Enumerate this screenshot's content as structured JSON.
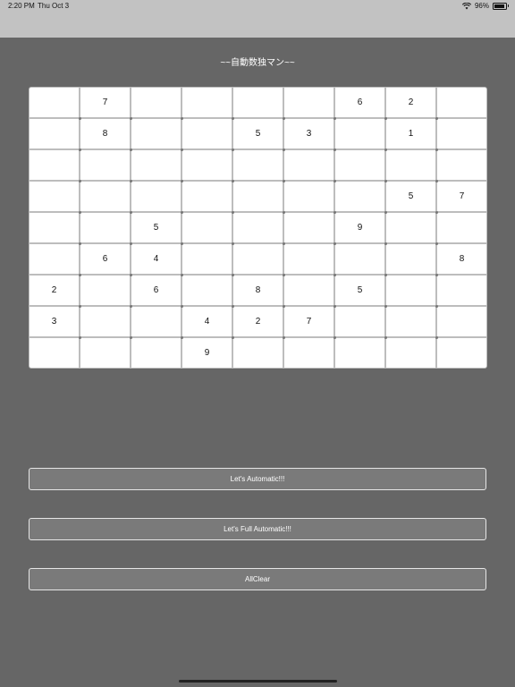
{
  "status_bar": {
    "time": "2:20 PM",
    "date": "Thu Oct 3",
    "battery": "96%"
  },
  "title": "~~自動数独マン~~",
  "grid": [
    [
      "",
      "7",
      "",
      "",
      "",
      "",
      "6",
      "2",
      ""
    ],
    [
      "",
      "8",
      "",
      "",
      "5",
      "3",
      "",
      "1",
      ""
    ],
    [
      "",
      "",
      "",
      "",
      "",
      "",
      "",
      "",
      ""
    ],
    [
      "",
      "",
      "",
      "",
      "",
      "",
      "",
      "5",
      "7"
    ],
    [
      "",
      "",
      "5",
      "",
      "",
      "",
      "9",
      "",
      ""
    ],
    [
      "",
      "6",
      "4",
      "",
      "",
      "",
      "",
      "",
      "8"
    ],
    [
      "2",
      "",
      "6",
      "",
      "8",
      "",
      "5",
      "",
      ""
    ],
    [
      "3",
      "",
      "",
      "4",
      "2",
      "7",
      "",
      "",
      ""
    ],
    [
      "",
      "",
      "",
      "9",
      "",
      "",
      "",
      "",
      ""
    ]
  ],
  "buttons": {
    "automatic": "Let's Automatic!!!",
    "full_automatic": "Let's Full Automatic!!!",
    "all_clear": "AllClear"
  }
}
